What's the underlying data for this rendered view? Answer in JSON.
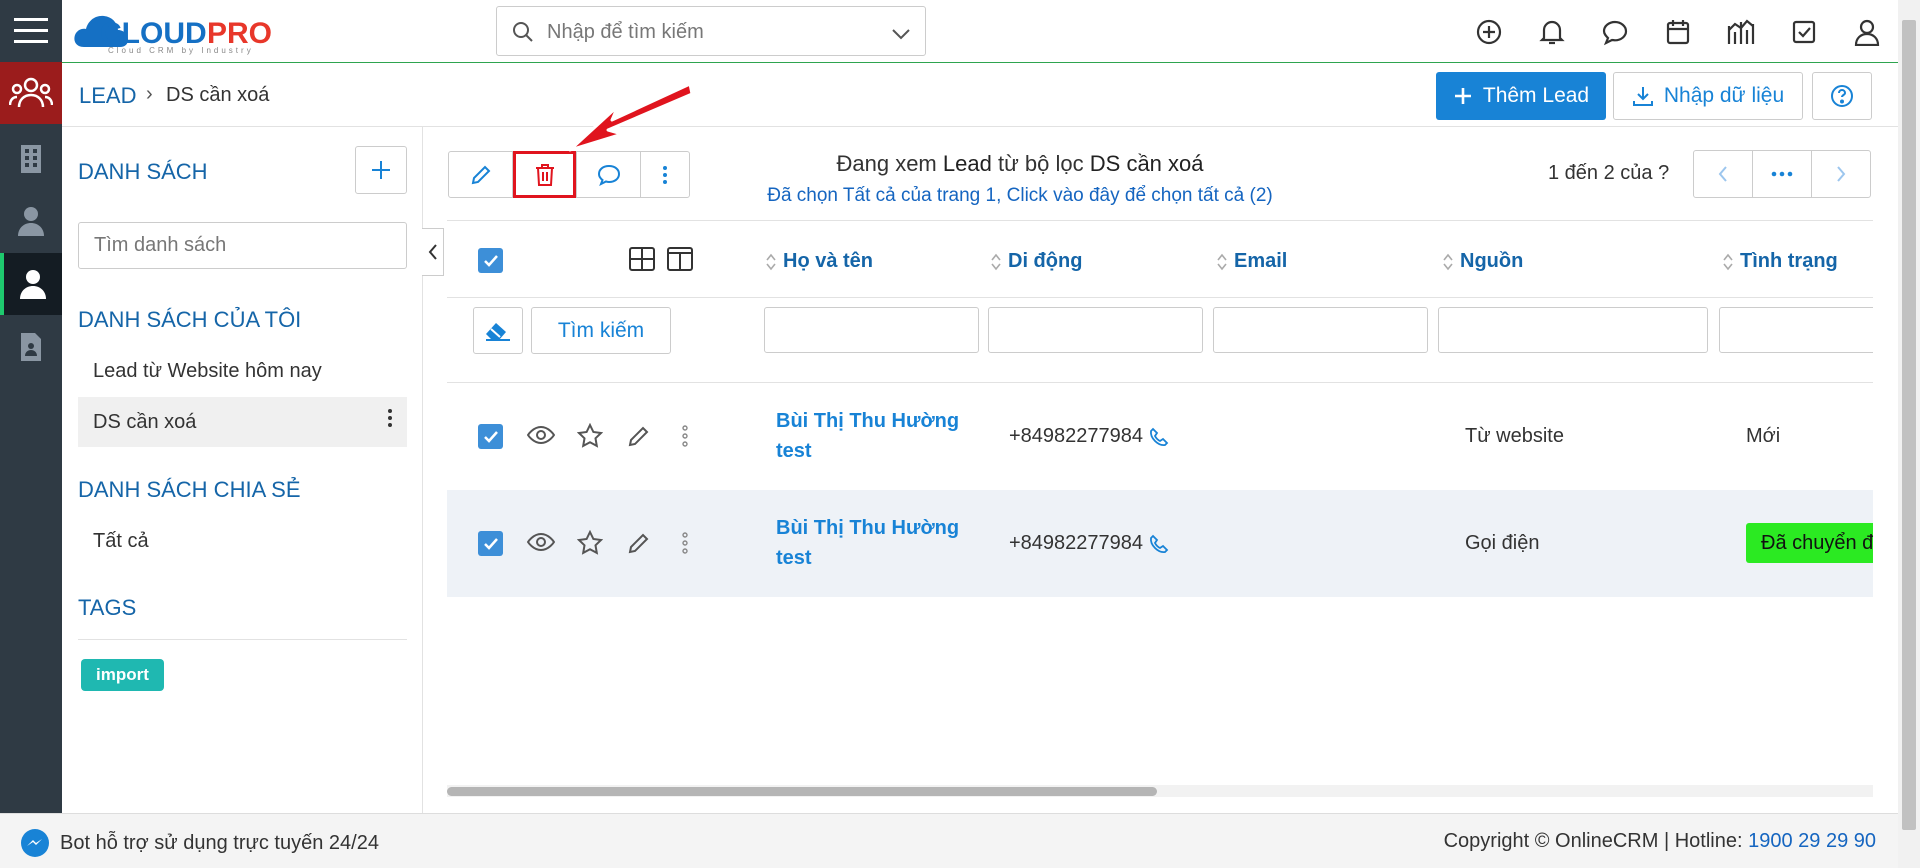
{
  "topbar": {
    "logo_text": "CLOUDPRO",
    "logo_tagline": "Cloud CRM by Industry",
    "search_placeholder": "Nhập để tìm kiếm"
  },
  "breadcrumb": {
    "root": "LEAD",
    "separator": "›",
    "current": "DS cần xoá"
  },
  "actions": {
    "add_lead": "Thêm Lead",
    "import": "Nhập dữ liệu"
  },
  "left_panel": {
    "title": "DANH SÁCH",
    "search_placeholder": "Tìm danh sách",
    "my_lists_title": "DANH SÁCH CỦA TÔI",
    "my_lists": [
      "Lead từ Website hôm nay",
      "DS cần xoá"
    ],
    "shared_title": "DANH SÁCH CHIA SẺ",
    "shared_lists": [
      "Tất cả"
    ],
    "tags_title": "TAGS",
    "tags": [
      "import"
    ]
  },
  "viewing": {
    "prefix": "Đang xem",
    "module": "Lead",
    "mid": "từ bộ lọc",
    "filter": "DS cần xoá",
    "selected_text": "Đã chọn Tất cả của trang 1, Click vào đây để chọn tất cả (2)"
  },
  "pager": {
    "text": "1 đến 2 của",
    "more": "?"
  },
  "table": {
    "columns": [
      "Họ và tên",
      "Di động",
      "Email",
      "Nguồn",
      "Tình trạng"
    ],
    "search_button": "Tìm kiếm",
    "rows": [
      {
        "name": "Bùi Thị Thu Hường test",
        "mobile": "+84982277984",
        "email": "",
        "source": "Từ website",
        "status": "Mới",
        "status_color": ""
      },
      {
        "name": "Bùi Thị Thu Hường test",
        "mobile": "+84982277984",
        "email": "",
        "source": "Gọi điện",
        "status": "Đã chuyển đổi",
        "status_color": "#2bea22"
      }
    ]
  },
  "footer": {
    "bot_text": "Bot hỗ trợ sử dụng trực tuyến 24/24",
    "copyright": "Copyright © OnlineCRM | Hotline: ",
    "hotline": "1900 29 29 90"
  },
  "colors": {
    "primary": "#1883d6",
    "rail": "#2f3a44",
    "highlight": "#e0141e",
    "status_green": "#2bea22",
    "tag": "#1fb8b1"
  }
}
